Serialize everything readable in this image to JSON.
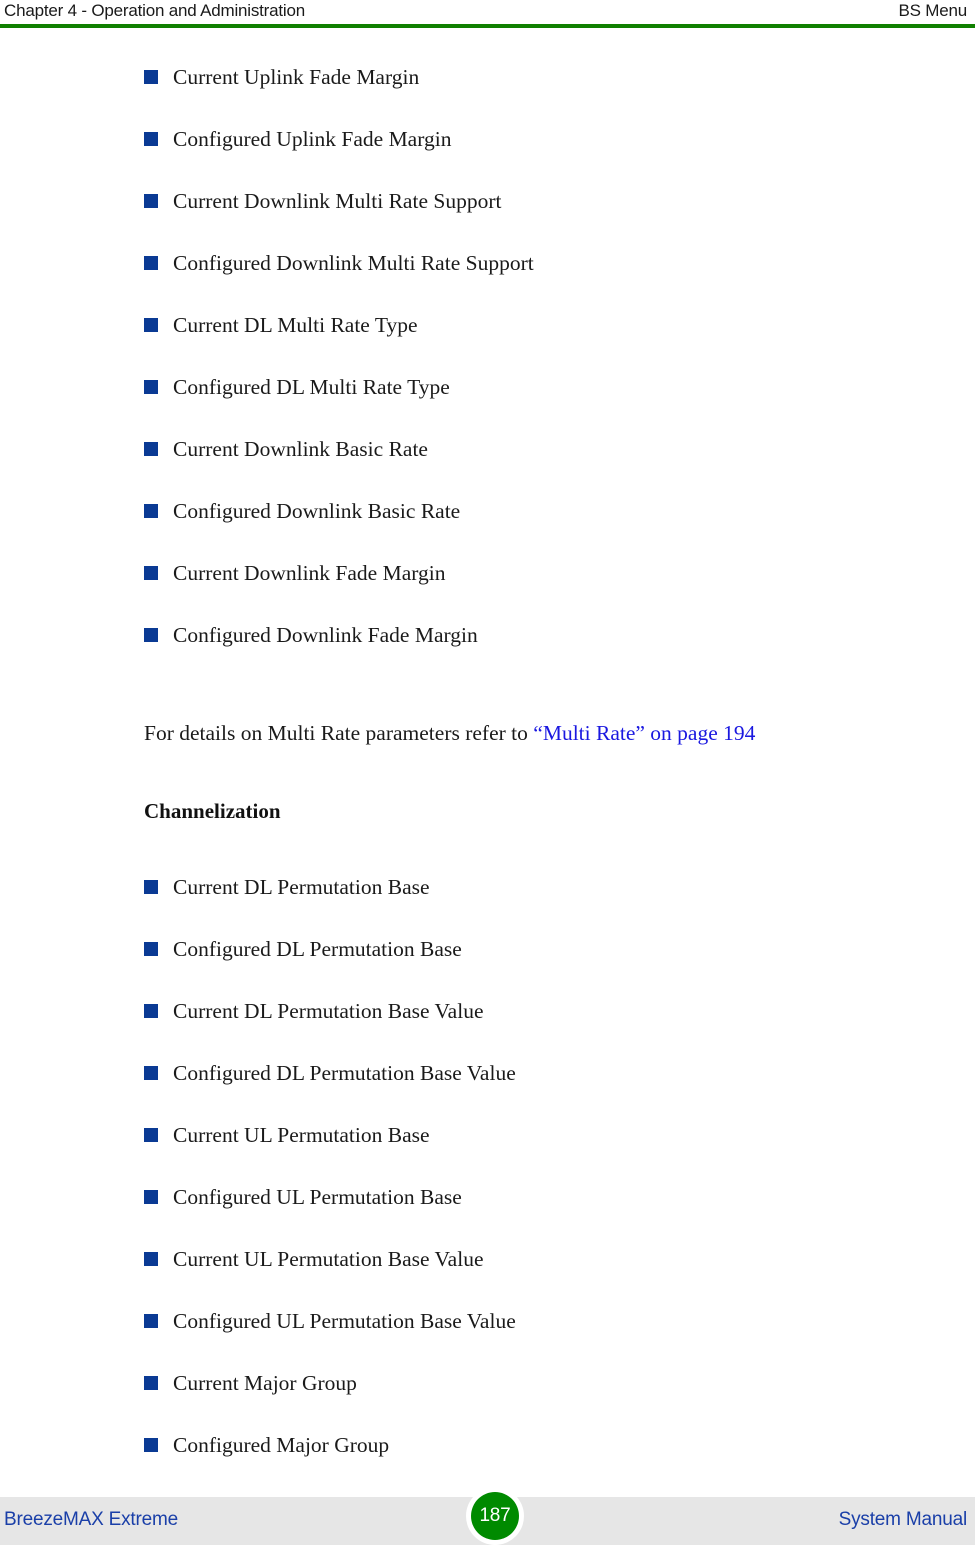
{
  "header": {
    "left": "Chapter 4 - Operation and Administration",
    "right": "BS Menu",
    "rule_color": "#108000"
  },
  "content": {
    "multi_rate_items": [
      {
        "label": "Current Uplink Fade Margin"
      },
      {
        "label": "Configured Uplink Fade Margin"
      },
      {
        "label": "Current Downlink Multi Rate Support"
      },
      {
        "label": "Configured Downlink Multi Rate Support"
      },
      {
        "label": "Current DL Multi Rate Type"
      },
      {
        "label": "Configured DL Multi Rate Type"
      },
      {
        "label": "Current Downlink Basic Rate"
      },
      {
        "label": "Configured Downlink Basic Rate"
      },
      {
        "label": "Current Downlink Fade Margin"
      },
      {
        "label": "Configured Downlink Fade Margin"
      }
    ],
    "paragraph": {
      "text_before_link": "For details on Multi Rate parameters refer to ",
      "link_text": "“Multi Rate” on page 194",
      "link_color": "#1a18e0"
    },
    "channelization_heading": "Channelization",
    "channelization_items": [
      {
        "label": "Current DL Permutation Base"
      },
      {
        "label": "Configured DL Permutation Base"
      },
      {
        "label": "Current DL Permutation Base Value"
      },
      {
        "label": "Configured DL Permutation Base Value"
      },
      {
        "label": "Current UL Permutation Base"
      },
      {
        "label": "Configured UL Permutation Base"
      },
      {
        "label": "Current UL Permutation Base Value"
      },
      {
        "label": "Configured UL Permutation Base Value"
      },
      {
        "label": "Current Major Group"
      },
      {
        "label": "Configured Major Group"
      }
    ],
    "bullet_color": "#0a3a94"
  },
  "footer": {
    "left": "BreezeMAX Extreme",
    "right": "System Manual",
    "page_number": "187",
    "text_color": "#1a3fa8",
    "badge_color": "#008a00",
    "band_color": "#e6e6e6"
  }
}
